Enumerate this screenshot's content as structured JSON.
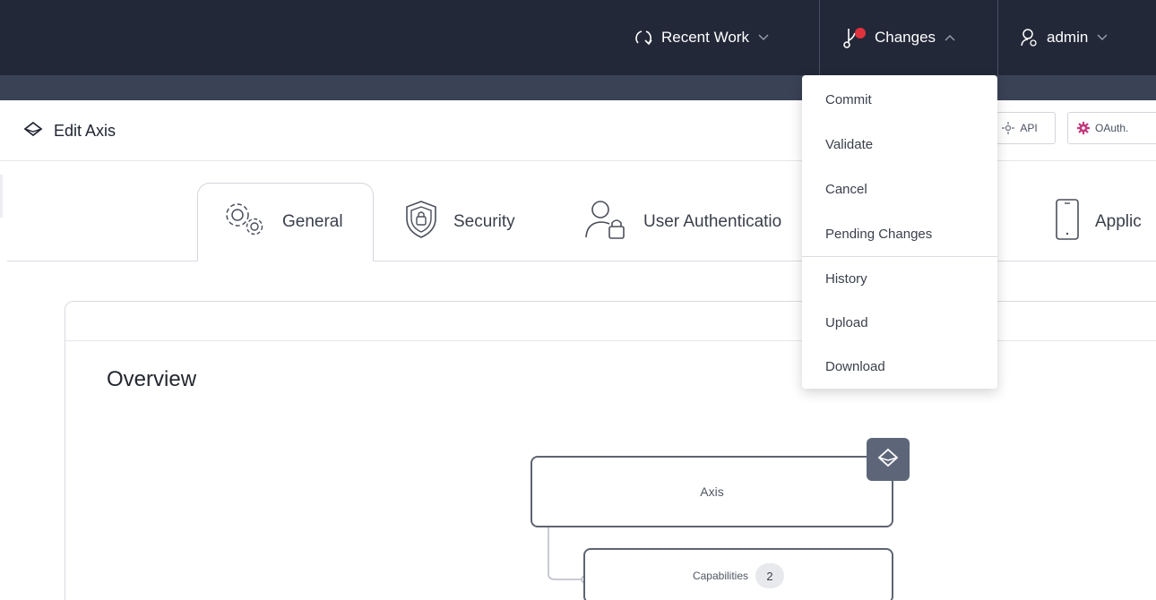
{
  "topbar": {
    "recent_work": "Recent Work",
    "changes": "Changes",
    "user": "admin"
  },
  "changes_menu": {
    "group1": [
      "Commit",
      "Validate",
      "Cancel",
      "Pending Changes"
    ],
    "group2": [
      "History",
      "Upload",
      "Download"
    ]
  },
  "header": {
    "title": "Edit Axis",
    "api_button": "API",
    "oauth_button": "OAuth."
  },
  "tabs": [
    {
      "label": "General",
      "active": true
    },
    {
      "label": "Security",
      "active": false
    },
    {
      "label": "User Authenticatio",
      "active": false
    },
    {
      "label": "Applic",
      "active": false
    }
  ],
  "main": {
    "section_title": "Overview",
    "diagram": {
      "root_label": "Axis",
      "child_label": "Capabilities",
      "child_count": "2"
    }
  },
  "colors": {
    "topbar": "#232838",
    "subbar": "#3a4256",
    "notification_dot": "#e0323c",
    "oauth_icon": "#c2387d"
  }
}
